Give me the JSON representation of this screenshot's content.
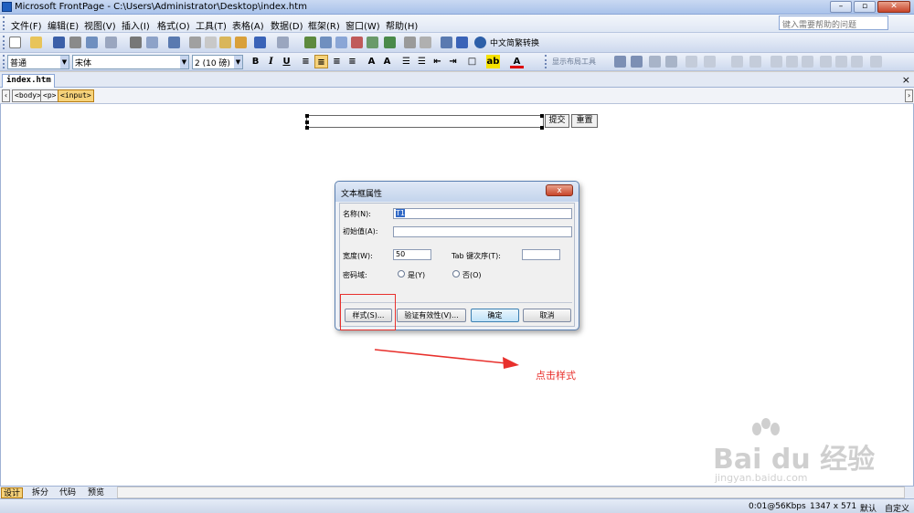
{
  "window": {
    "title": "Microsoft FrontPage - C:\\Users\\Administrator\\Desktop\\index.htm",
    "controls": [
      "–",
      "▫",
      "✕"
    ]
  },
  "menubar": {
    "items": [
      "文件(F)",
      "编辑(E)",
      "视图(V)",
      "插入(I)",
      "格式(O)",
      "工具(T)",
      "表格(A)",
      "数据(D)",
      "框架(R)",
      "窗口(W)",
      "帮助(H)"
    ],
    "help_placeholder": "键入需要帮助的问题"
  },
  "toolbar": {
    "zh_convert_label": "中文简繁转换",
    "show_layout_tool": "显示布局工具"
  },
  "format_toolbar": {
    "style_value": "普通",
    "font_value": "宋体",
    "size_value": "2 (10 磅)",
    "bold": "B",
    "italic": "I",
    "underline": "U",
    "font_color_label": "A"
  },
  "document": {
    "tab_label": "index.htm",
    "tab_close": "×",
    "tags": [
      "<body>",
      "<p>",
      "<input>"
    ]
  },
  "form": {
    "submit_label": "提交",
    "reset_label": "重置"
  },
  "dialog": {
    "title": "文本框属性",
    "close": "x",
    "name_label": "名称(N):",
    "name_value": "T1",
    "initial_label": "初始值(A):",
    "initial_value": "",
    "width_label": "宽度(W):",
    "width_value": "50",
    "tab_order_label": "Tab 键次序(T):",
    "tab_order_value": "",
    "password_label": "密码域:",
    "yes_label": "是(Y)",
    "no_label": "否(O)",
    "password_selected": "否",
    "style_button": "样式(S)...",
    "validate_button": "验证有效性(V)...",
    "ok_button": "确定",
    "cancel_button": "取消"
  },
  "annotation": {
    "text": "点击样式",
    "color": "#e8302c"
  },
  "watermark": {
    "text": "Bai du 经验",
    "sub": "jingyan.baidu.com"
  },
  "view_tabs": [
    "设计",
    "拆分",
    "代码",
    "预览"
  ],
  "active_view": "设计",
  "statusbar": {
    "speed": "0:01@56Kbps",
    "size": "1347 x 571",
    "mode": "默认",
    "custom": "自定义"
  },
  "colors": {
    "accent": "#3169c6",
    "highlight": "#f6d27a",
    "annotation": "#e8302c"
  }
}
